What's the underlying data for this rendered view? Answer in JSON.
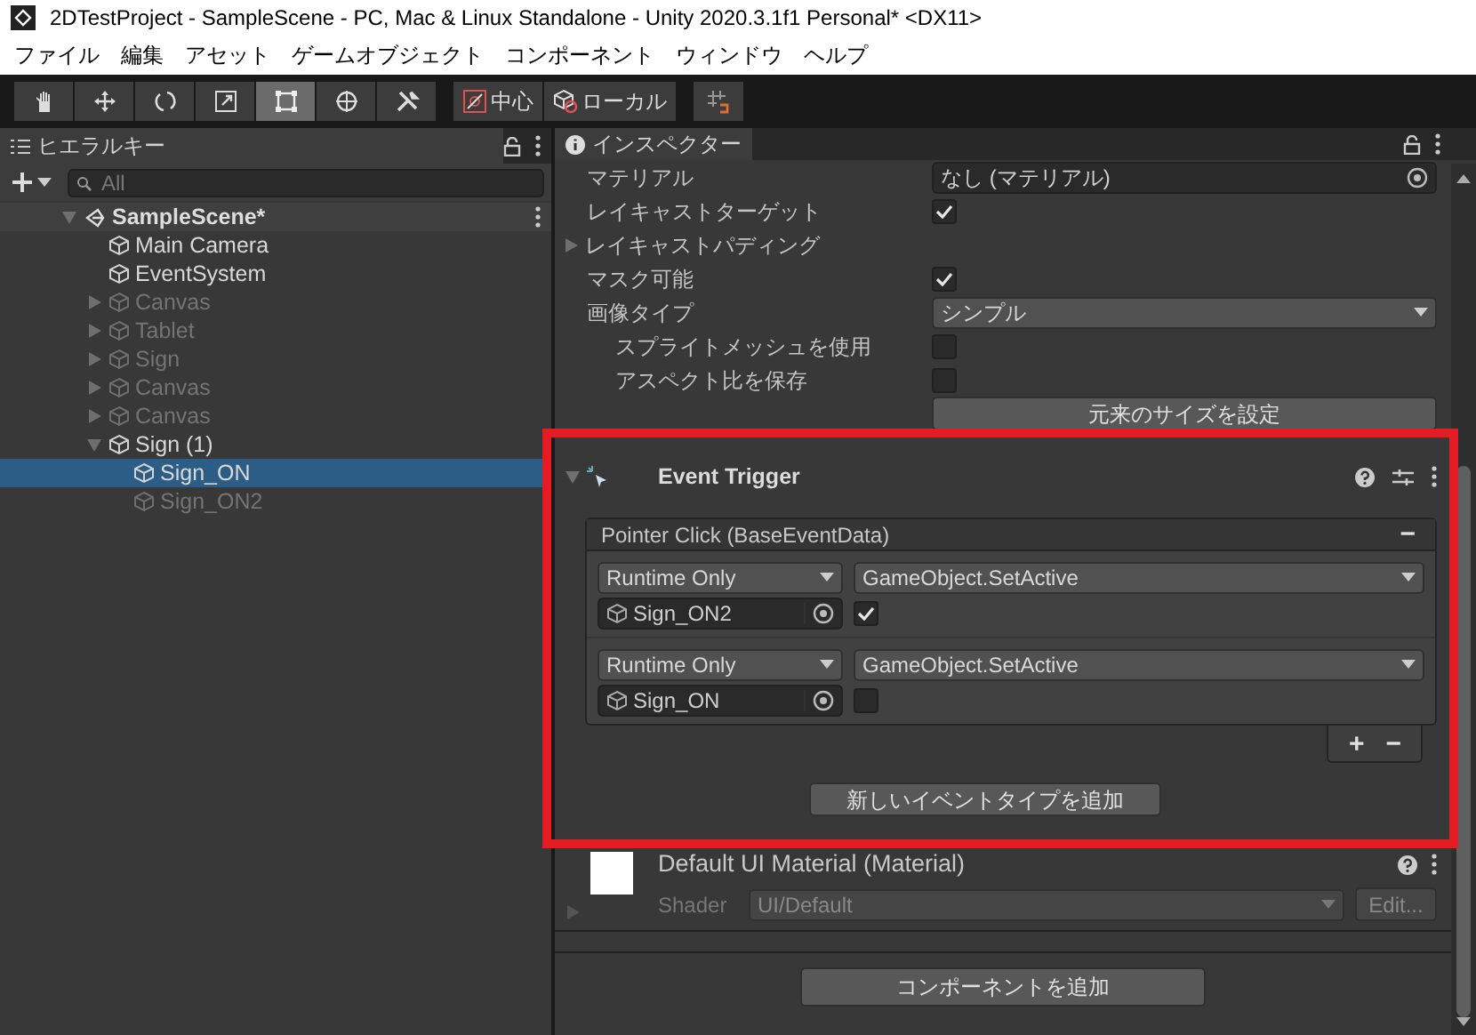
{
  "window": {
    "title": "2DTestProject - SampleScene - PC, Mac & Linux Standalone - Unity 2020.3.1f1 Personal* <DX11>"
  },
  "menu": [
    "ファイル",
    "編集",
    "アセット",
    "ゲームオブジェクト",
    "コンポーネント",
    "ウィンドウ",
    "ヘルプ"
  ],
  "toolbar": {
    "tools": [
      {
        "kind": "hand",
        "selected": false
      },
      {
        "kind": "move",
        "selected": false
      },
      {
        "kind": "rotate",
        "selected": false
      },
      {
        "kind": "scale",
        "selected": false
      },
      {
        "kind": "rect",
        "selected": true
      },
      {
        "kind": "transform",
        "selected": false
      },
      {
        "kind": "custom",
        "selected": false
      }
    ],
    "pivot": "中心",
    "space": "ローカル"
  },
  "hierarchy": {
    "title": "ヒエラルキー",
    "placeholder": "All",
    "scene": {
      "name": "SampleScene*",
      "expanded": true,
      "children": [
        {
          "name": "Main Camera",
          "active": true,
          "selected": false
        },
        {
          "name": "EventSystem",
          "active": true,
          "selected": false
        },
        {
          "name": "Canvas",
          "active": false,
          "selected": false,
          "expanded": false
        },
        {
          "name": "Tablet",
          "active": false,
          "selected": false,
          "expanded": false
        },
        {
          "name": "Sign",
          "active": false,
          "selected": false,
          "expanded": false
        },
        {
          "name": "Canvas",
          "active": false,
          "selected": false,
          "expanded": false
        },
        {
          "name": "Canvas",
          "active": false,
          "selected": false,
          "expanded": false
        },
        {
          "name": "Sign (1)",
          "active": true,
          "selected": false,
          "expanded": true,
          "children": [
            {
              "name": "Sign_ON",
              "active": true,
              "selected": true
            },
            {
              "name": "Sign_ON2",
              "active": false,
              "selected": false
            }
          ]
        }
      ]
    }
  },
  "inspector": {
    "title": "インスペクター",
    "properties": [
      {
        "kind": "object",
        "label": "マテリアル",
        "value": "なし (マテリアル)"
      },
      {
        "kind": "checkbox",
        "label": "レイキャストターゲット",
        "checked": true
      },
      {
        "kind": "foldout",
        "label": "レイキャストパディング",
        "expanded": false
      },
      {
        "kind": "checkbox",
        "label": "マスク可能",
        "checked": true
      },
      {
        "kind": "dropdown",
        "label": "画像タイプ",
        "value": "シンプル",
        "children": [
          {
            "kind": "checkbox",
            "label": "スプライトメッシュを使用",
            "checked": false
          },
          {
            "kind": "checkbox",
            "label": "アスペクト比を保存",
            "checked": false
          }
        ]
      },
      {
        "kind": "button",
        "label": "元来のサイズを設定"
      }
    ],
    "event_trigger": {
      "title": "Event Trigger",
      "expanded": true,
      "entries": [
        {
          "title": "Pointer Click (BaseEventData)",
          "remove_symbol": "−",
          "calls": [
            {
              "mode": "Runtime Only",
              "function": "GameObject.SetActive",
              "target": "Sign_ON2",
              "checked": true
            },
            {
              "mode": "Runtime Only",
              "function": "GameObject.SetActive",
              "target": "Sign_ON",
              "checked": false
            }
          ],
          "add_symbol": "+",
          "remove_call_symbol": "−"
        }
      ],
      "add_button": "新しいイベントタイプを追加"
    },
    "material": {
      "name": "Default UI Material (Material)",
      "shader_label": "Shader",
      "shader": "UI/Default",
      "edit_button": "Edit..."
    },
    "add_component": "コンポーネントを追加"
  }
}
